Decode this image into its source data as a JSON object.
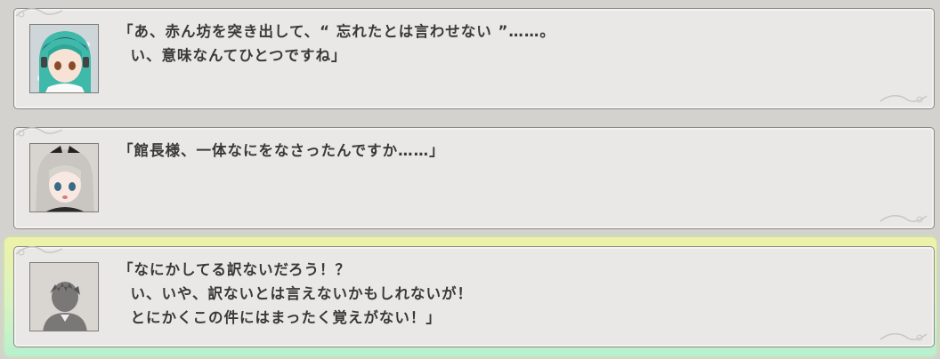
{
  "log": [
    {
      "speaker_icon": "teal-hair-girl-portrait",
      "lines": [
        "「あ、赤ん坊を突き出して、“ 忘れたとは言わせない ”……。",
        "  い、意味なんてひとつですね」"
      ]
    },
    {
      "speaker_icon": "silver-hair-girl-portrait",
      "lines": [
        "「館長様、一体なにをなさったんですか……」"
      ]
    },
    {
      "speaker_icon": "protagonist-silhouette-portrait",
      "lines": [
        "「なにかしてる訳ないだろう！？",
        "  い、いや、訳ないとは言えないかもしれないが！",
        "  とにかくこの件にはまったく覚えがない！」"
      ],
      "selected": true
    }
  ],
  "colors": {
    "panel_bg": "#e9e8e6",
    "page_bg": "#d3d2ce",
    "selection_glow": "#c7ee9e",
    "text": "#3a3937"
  }
}
